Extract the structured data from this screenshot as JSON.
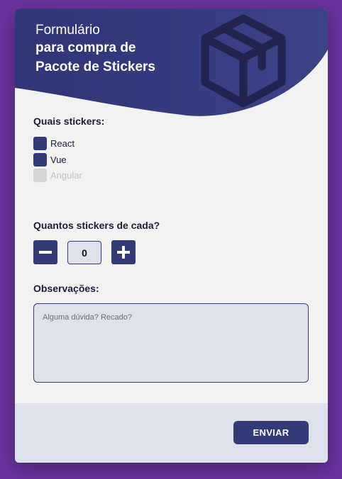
{
  "header": {
    "title_line1": "Formulário",
    "title_line2": "para compra de",
    "title_line3": "Pacote de Stickers",
    "icon": "package-box-icon"
  },
  "stickers": {
    "label": "Quais stickers:",
    "options": [
      {
        "label": "React",
        "enabled": true
      },
      {
        "label": "Vue",
        "enabled": true
      },
      {
        "label": "Angular",
        "enabled": false
      }
    ]
  },
  "quantity": {
    "label": "Quantos stickers de cada?",
    "value": "0",
    "decrement_icon": "minus-icon",
    "increment_icon": "plus-icon"
  },
  "notes": {
    "label": "Observações:",
    "value": "",
    "placeholder": "Alguma dúvida? Recado?"
  },
  "footer": {
    "submit_label": "ENVIAR"
  },
  "colors": {
    "background": "#6a34a0",
    "primary": "#333a78",
    "card": "#f2f2f3",
    "field": "#dde1e9",
    "disabled": "#d4d4d6"
  }
}
